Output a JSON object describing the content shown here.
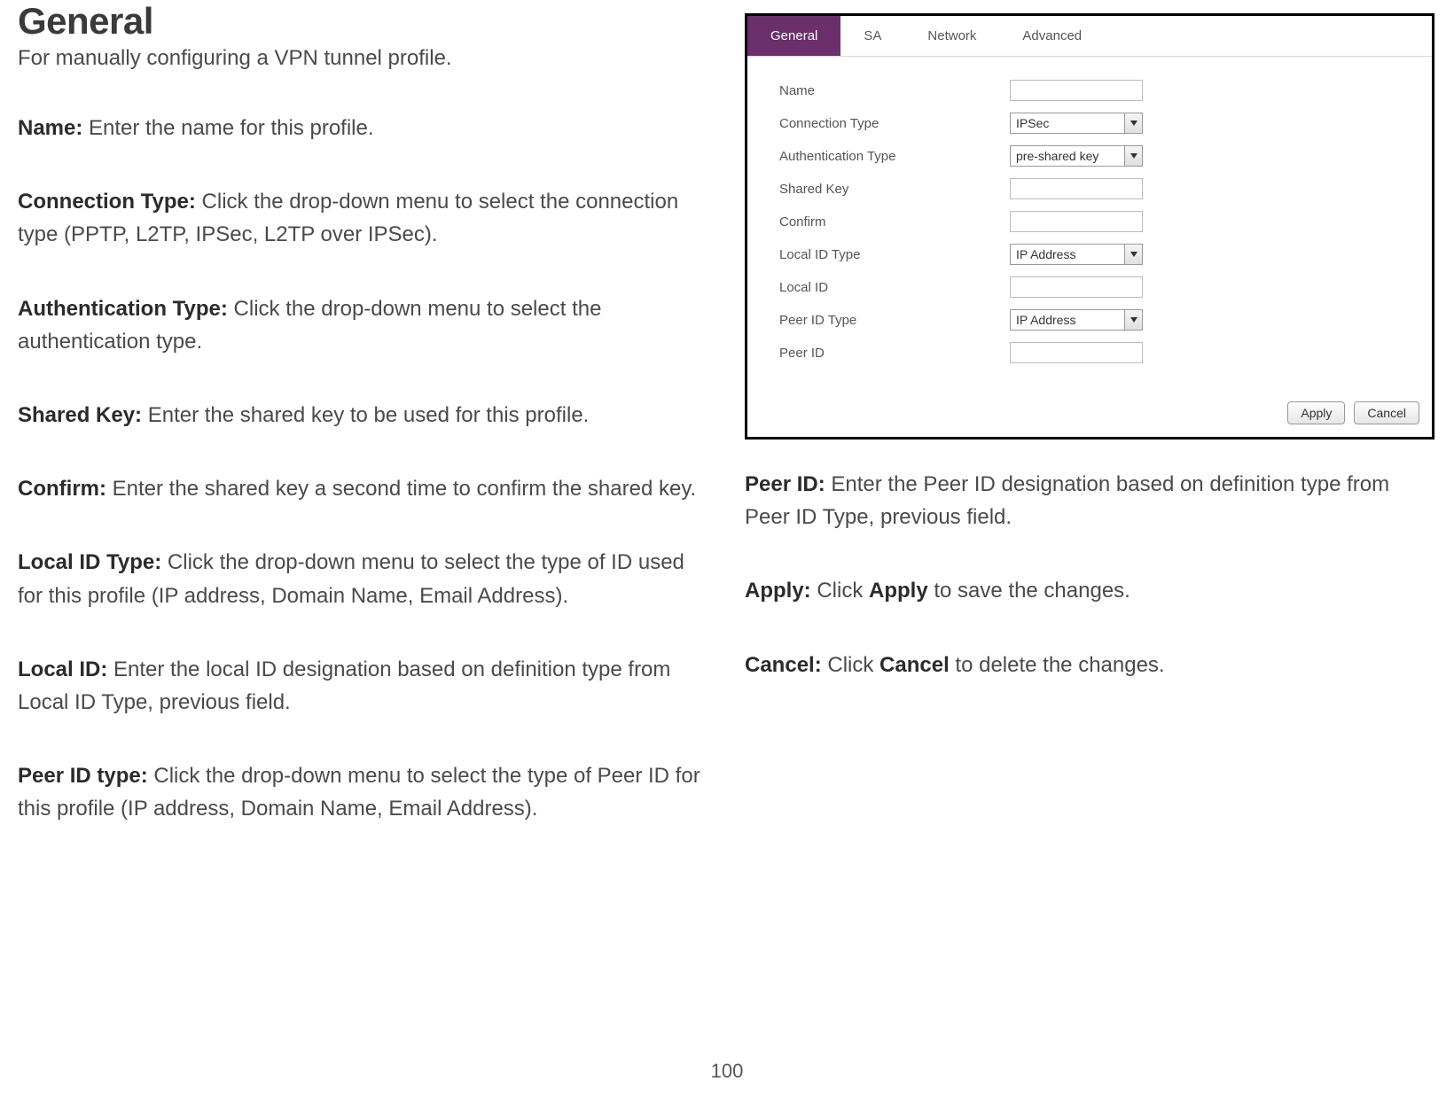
{
  "heading": "General",
  "subtitle": "For manually configuring a VPN tunnel profile.",
  "fields_left": [
    {
      "label": "Name:",
      "text": " Enter the name for this profile."
    },
    {
      "label": "Connection Type:",
      "text": " Click the drop-down menu to select the connection type (PPTP, L2TP, IPSec, L2TP over IPSec)."
    },
    {
      "label": "Authentication Type:",
      "text": " Click the drop-down menu to select the authentication type."
    },
    {
      "label": "Shared Key:",
      "text": " Enter the shared key to be used for this profile."
    },
    {
      "label": "Confirm:",
      "text": " Enter the shared key a second time to confirm the shared key."
    },
    {
      "label": "Local ID Type:",
      "text": " Click the drop-down menu to select the type of ID used for this profile (IP address, Domain Name, Email Address)."
    },
    {
      "label": "Local ID:",
      "text": " Enter the local ID designation based on definition type from Local ID Type, previous field."
    },
    {
      "label": "Peer ID type:",
      "text": " Click the drop-down menu to select the type of Peer ID for this profile (IP address, Domain Name, Email Address)."
    }
  ],
  "fields_right": [
    {
      "label": "Peer ID:",
      "text": " Enter the Peer ID designation based on definition type from Peer ID Type, previous field."
    },
    {
      "label": "Apply:",
      "pre": " Click ",
      "strong": "Apply",
      "post": " to save the changes."
    },
    {
      "label": "Cancel:",
      "pre": " Click ",
      "strong": "Cancel",
      "post": " to delete the changes."
    }
  ],
  "panel": {
    "tabs": [
      "General",
      "SA",
      "Network",
      "Advanced"
    ],
    "active_tab": 0,
    "rows": [
      {
        "label": "Name",
        "type": "text",
        "value": ""
      },
      {
        "label": "Connection Type",
        "type": "select",
        "value": "IPSec"
      },
      {
        "label": "Authentication Type",
        "type": "select",
        "value": "pre-shared key"
      },
      {
        "label": "Shared Key",
        "type": "text",
        "value": ""
      },
      {
        "label": "Confirm",
        "type": "text",
        "value": ""
      },
      {
        "label": "Local ID Type",
        "type": "select",
        "value": "IP Address"
      },
      {
        "label": "Local ID",
        "type": "text",
        "value": ""
      },
      {
        "label": "Peer ID Type",
        "type": "select",
        "value": "IP Address"
      },
      {
        "label": "Peer ID",
        "type": "text",
        "value": ""
      }
    ],
    "buttons": {
      "apply": "Apply",
      "cancel": "Cancel"
    }
  },
  "page_number": "100"
}
